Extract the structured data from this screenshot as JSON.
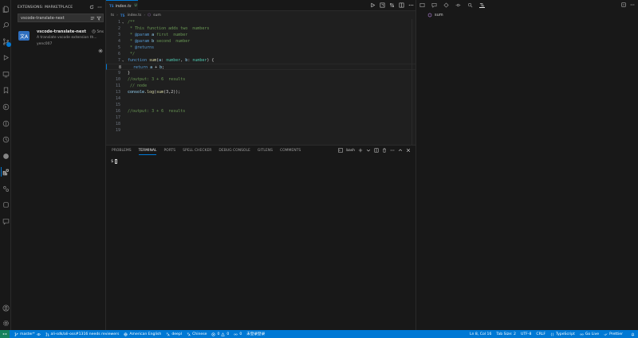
{
  "sidebar": {
    "title": "EXTENSIONS: MARKETPLACE",
    "search_value": "vscode-translate-next",
    "extension": {
      "name": "vscode-translate-next",
      "size": "5ms",
      "description": "A translate vscode extension th...",
      "author": "yenc007",
      "logo_text": "文A"
    }
  },
  "editor": {
    "tab_badge": "TS",
    "tab_label": "index.ts",
    "tab_status": "U",
    "breadcrumb": [
      "ts",
      "index.ts",
      "sum"
    ],
    "breadcrumb_ts": "TS",
    "lines": [
      {
        "n": "1",
        "fold": "v",
        "parts": [
          [
            "cm",
            "/**"
          ]
        ]
      },
      {
        "n": "2",
        "parts": [
          [
            "cm",
            " * This function adds two  numbers"
          ]
        ]
      },
      {
        "n": "3",
        "parts": [
          [
            "cm",
            " * "
          ],
          [
            "cm-tag",
            "@param"
          ],
          [
            "cm",
            " "
          ],
          [
            "cm-pm",
            "a"
          ],
          [
            "cm",
            " first  number"
          ]
        ]
      },
      {
        "n": "4",
        "parts": [
          [
            "cm",
            " * "
          ],
          [
            "cm-tag",
            "@param"
          ],
          [
            "cm",
            " "
          ],
          [
            "cm-pm",
            "b"
          ],
          [
            "cm",
            " second  number"
          ]
        ]
      },
      {
        "n": "5",
        "parts": [
          [
            "cm",
            " * "
          ],
          [
            "cm-tag",
            "@returns"
          ]
        ]
      },
      {
        "n": "6",
        "parts": [
          [
            "cm",
            " */"
          ]
        ]
      },
      {
        "n": "7",
        "fold": "v",
        "parts": [
          [
            "kw",
            "function"
          ],
          [
            "plain",
            " "
          ],
          [
            "fn",
            "sum"
          ],
          [
            "plain",
            "("
          ],
          [
            "pm",
            "a"
          ],
          [
            "plain",
            ": "
          ],
          [
            "ty",
            "number"
          ],
          [
            "plain",
            ", "
          ],
          [
            "pm",
            "b"
          ],
          [
            "plain",
            ": "
          ],
          [
            "ty",
            "number"
          ],
          [
            "plain",
            ") {"
          ]
        ]
      },
      {
        "n": "8",
        "current": true,
        "parts": [
          [
            "plain",
            "  "
          ],
          [
            "kw",
            "return"
          ],
          [
            "plain",
            " "
          ],
          [
            "pm",
            "a"
          ],
          [
            "plain",
            " + "
          ],
          [
            "pm",
            "b"
          ],
          [
            "plain",
            ";"
          ]
        ]
      },
      {
        "n": "9",
        "parts": [
          [
            "plain",
            "}"
          ]
        ]
      },
      {
        "n": "10",
        "parts": [
          [
            "cm",
            "//output: 3 + 6  results"
          ]
        ]
      },
      {
        "n": "11",
        "parts": [
          [
            "cm",
            " // node"
          ]
        ]
      },
      {
        "n": "13",
        "parts": [
          [
            "pm",
            "console"
          ],
          [
            "plain",
            "."
          ],
          [
            "fn",
            "log"
          ],
          [
            "plain",
            "("
          ],
          [
            "fn",
            "sum"
          ],
          [
            "plain",
            "(3,2));"
          ]
        ]
      },
      {
        "n": "14",
        "parts": []
      },
      {
        "n": "15",
        "parts": []
      },
      {
        "n": "16",
        "parts": [
          [
            "cm",
            "//output: 3 + 6  results"
          ]
        ]
      },
      {
        "n": "17",
        "parts": []
      },
      {
        "n": "18",
        "parts": []
      },
      {
        "n": "19",
        "parts": []
      }
    ]
  },
  "panel": {
    "tabs": [
      "PROBLEMS",
      "TERMINAL",
      "PORTS",
      "SPELL CHECKER",
      "DEBUG CONSOLE",
      "GITLENS",
      "COMMENTS"
    ],
    "active_tab": "TERMINAL",
    "shell_label": "bash",
    "prompt": "$"
  },
  "outline": {
    "item": "sum"
  },
  "statusbar": {
    "branch": "master*",
    "pr": "ali-sdk/ali-oss#1316 needs reviewers",
    "language_check": "American English",
    "deepl": "deepl",
    "translate": "Chinese",
    "errors": "0",
    "warnings": "0",
    "ports": "0",
    "ext_status": "未登录登录",
    "position": "Ln 8, Col 16",
    "tab_size": "Tab Size: 2",
    "encoding": "UTF-8",
    "eol": "CRLF",
    "language": "TypeScript",
    "golive": "Go Live",
    "prettier": "Prettier"
  }
}
